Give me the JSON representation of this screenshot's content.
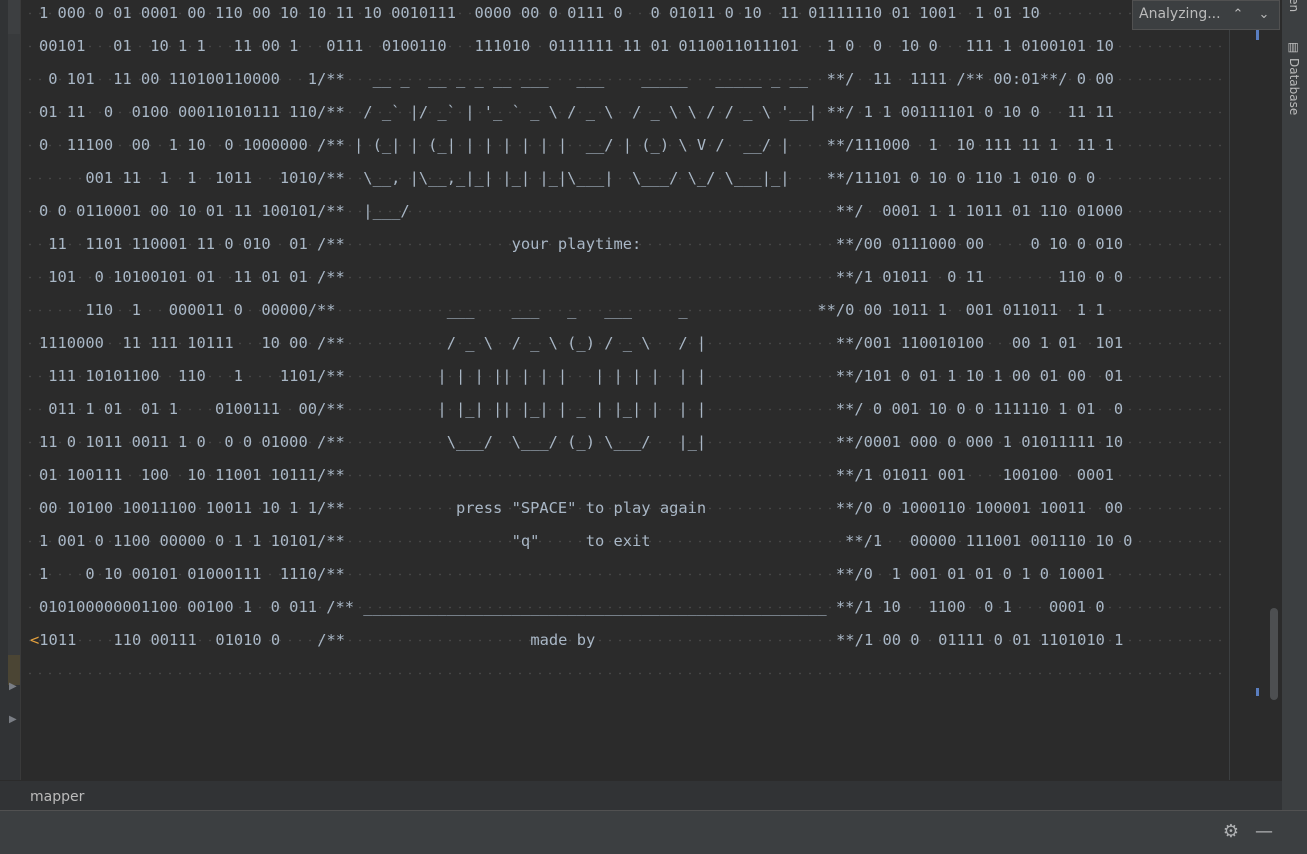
{
  "editor": {
    "lines": [
      "1 000 0 01 0001 00 110 00 10 10 11 10 0010111  0000 00 0 0111 0   0 01011 0 10  11 01111110 01 1001  1 01 10",
      "00101   01  10 1 1   11 00 1   0111  0100110   111010  0111111 11 01 0110011011101   1 0  0  10 0   111 1 0100101 10",
      " 0 101  11 00 110100110000   1/**   __ _  __ _ _ __ ___   ___    _____   _____ _ __  **/  11  1111 /** 00:01**/ 0 00",
      "01 11  0  0100 00011010111 110/**  / _` |/ _` | '_ ` _ \\ / _ \\  / _ \\ \\ / / _ \\ '__| **/ 1 1 00111101 0 10 0   11 11",
      "0  11100  00  1 10  0 1000000 /** | (_| | (_| | | | | | |  __/ | (_) \\ V /  __/ |    **/111000  1  10 111 11 1  11 1",
      "     001 11  1  1  1011   1010/**  \\__, |\\__,_|_| |_| |_|\\___|  \\___/ \\_/ \\___|_|    **/11101 0 10 0 110 1 010 0 0",
      "0 0 0110001 00 10 01 11 100101/**  |___/                                              **/  0001 1 1 1011 01 110 01000",
      " 11  1101 110001 11 0 010  01 /**                  your playtime:                     **/00 0111000 00     0 10 0 010",
      " 101  0 10100101 01  11 01 01 /**                                                     **/1 01011  0 11        110 0 0",
      "     110  1   000011 0  00000/**            ___    ___   _   ___     _              **/0 00 1011 1  001 011011  1 1",
      "1110000  11 111 10111   10 00 /**           / _ \\  / _ \\ (_) / _ \\   / |              **/001 110010100   00 1 01  101",
      " 111 10101100  110   1    1101/**          | | | || | | |   | | | |  | |              **/101 0 01 1 10 1 00 01 00  01",
      " 011 1 01  01 1    0100111  00/**          | |_| || |_| | _ | |_| |  | |              **/ 0 001 10 0 0 111110 1 01  0",
      "11 0 1011 0011 1 0  0 0 01000 /**           \\___/  \\___/ (_) \\___/   |_|              **/0001 000 0 000 1 01011111 10",
      "01 100111  100  10 11001 10111/**                                                     **/1 01011 001    100100  0001",
      "00 10100 10011100 10011 10 1 1/**            press \"SPACE\" to play again              **/0 0 1000110 100001 10011  00",
      "1 001 0 1100 00000 0 1 1 10101/**                  \"q\"     to exit                     **/1   00000 111001 001110 10 0",
      "1    0 10 00101 01000111  1110/**                                                     **/0  1 001 01 01 0 1 0 10001",
      "010100000001100 00100 1  0 011 /** __________________________________________________ **/1 10   1100  0 1    0001 0",
      "<1011    110 00111  01010 0    /**                    made by                          **/1 00 0  01111 0 01 1101010 1"
    ]
  },
  "find_bar": {
    "status_label": "Analyzing...",
    "prev_icon_glyph": "⌃",
    "next_icon_glyph": "⌄"
  },
  "right_stripe": {
    "top_label": "ven",
    "database_label": "Database"
  },
  "breadcrumb": {
    "label": "mapper"
  },
  "tool_window": {
    "settings_glyph": "⚙",
    "minimize_glyph": "—"
  }
}
